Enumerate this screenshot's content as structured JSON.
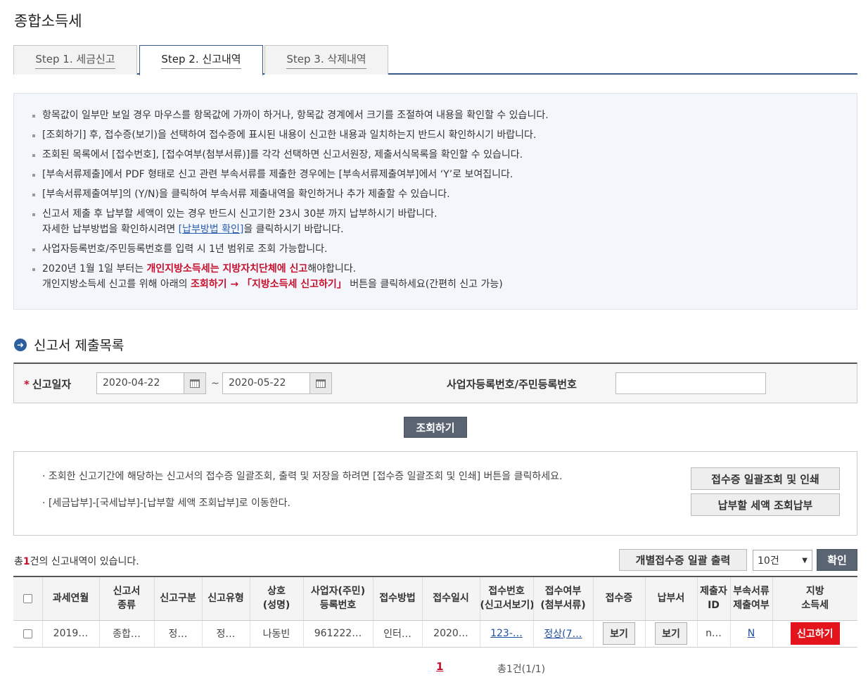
{
  "page": {
    "title": "종합소득세"
  },
  "tabs": [
    {
      "label": "Step 1. 세금신고"
    },
    {
      "label": "Step 2. 신고내역"
    },
    {
      "label": "Step 3. 삭제내역"
    }
  ],
  "notice": {
    "items": [
      "항목값이 일부만 보일 경우 마우스를 항목값에 가까이 하거나, 항목값 경계에서 크기를 조절하여 내용을 확인할 수 있습니다.",
      "[조회하기] 후, 접수증(보기)을 선택하여 접수증에 표시된 내용이 신고한 내용과 일치하는지 반드시 확인하시기 바랍니다.",
      "조회된 목록에서 [접수번호], [접수여부(첨부서류)]를 각각 선택하면 신고서원장, 제출서식목록을 확인할 수 있습니다.",
      "[부속서류제출]에서 PDF 형태로 신고 관련 부속서류를 제출한 경우에는 [부속서류제출여부]에서 ‘Y’로 보여집니다.",
      "[부속서류제출여부]의 (Y/N)을 클릭하여 부속서류 제출내역을 확인하거나 추가 제출할 수 있습니다."
    ],
    "item6_line1": "신고서 제출 후 납부할 세액이 있는 경우 반드시 신고기한 23시 30분 까지 납부하시기 바랍니다.",
    "item6_line2_pre": "자세한 납부방법을 확인하시려면 ",
    "item6_link": "[납부방법 확인]",
    "item6_line2_post": "을 클릭하시기 바랍니다.",
    "item7": "사업자등록번호/주민등록번호를 입력 시 1년 범위로 조회 가능합니다.",
    "item8_pre": "2020년 1월 1일 부터는 ",
    "item8_red": "개인지방소득세는 지방자치단체에 신고",
    "item8_post": "해야합니다.",
    "item8_line2_pre": "개인지방소득세 신고를 위해 아래의 ",
    "item8_line2_red": "조회하기 → 「지방소득세 신고하기」",
    "item8_line2_post": " 버튼을 클릭하세요(간편히 신고 가능)"
  },
  "section": {
    "title": "신고서 제출목록",
    "icon": "arrow-circle-icon",
    "glyph": "➜"
  },
  "search": {
    "required_mark": "*",
    "date_label": "신고일자",
    "date_from": "2020-04-22",
    "date_to": "2020-05-22",
    "tilde": "~",
    "reg_label": "사업자등록번호/주민등록번호",
    "reg_value": "",
    "search_button": "조회하기"
  },
  "info": {
    "line1": "· 조회한 신고기간에 해당하는 신고서의 접수증 일괄조회, 출력 및 저장을 하려면 [접수증 일괄조회 및 인쇄] 버튼을 클릭하세요.",
    "line2": "· [세금납부]-[국세납부]-[납부할 세액 조회납부]로 이동한다.",
    "btn_batch": "접수증 일괄조회 및 인쇄",
    "btn_pay": "납부할 세액 조회납부"
  },
  "list": {
    "total_pre": "총",
    "total_count": "1",
    "total_post": "건의 신고내역이 있습니다.",
    "btn_print": "개별접수증 일괄 출력",
    "page_size": "10건",
    "btn_confirm": "확인",
    "headers": [
      "",
      "과세연월",
      "신고서\n종류",
      "신고구분",
      "신고유형",
      "상호\n(성명)",
      "사업자(주민)\n등록번호",
      "접수방법",
      "접수일시",
      "접수번호\n(신고서보기)",
      "접수여부\n(첨부서류)",
      "접수증",
      "납부서",
      "제출자\nID",
      "부속서류\n제출여부",
      "지방\n소득세"
    ],
    "rows": [
      {
        "period": "2019…",
        "type": "종합…",
        "category": "정…",
        "kind": "정…",
        "name": "나동빈",
        "reg_no": "961222…",
        "method": "인터…",
        "datetime": "2020…",
        "receipt_no": "123-…",
        "status": "정상(7…",
        "receipt_btn": "보기",
        "bill_btn": "보기",
        "submitter": "n…",
        "attach": "N",
        "local_btn": "신고하기"
      }
    ]
  },
  "pager": {
    "current": "1",
    "info": "총1건(1/1)"
  }
}
